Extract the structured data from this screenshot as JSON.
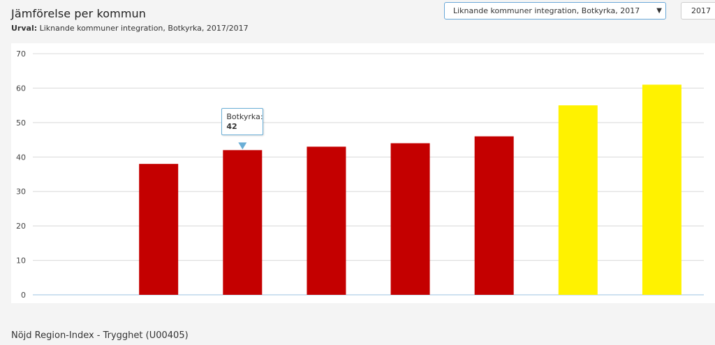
{
  "header": {
    "title": "Jämförelse per kommun",
    "subtitle_label": "Urval:",
    "subtitle_text": "Liknande kommuner integration, Botkyrka, 2017/2017"
  },
  "controls": {
    "comparison_select_value": "Liknande kommuner integration, Botkyrka, 2017",
    "year_select_value": "2017",
    "dropdown_icon": "caret-down-icon"
  },
  "footer": {
    "section_title": "Nöjd Region-Index - Trygghet (U00405)"
  },
  "colors": {
    "red": "#c40000",
    "yellow": "#fff200",
    "grid": "#d8d8d8",
    "axis": "#9ec3e0",
    "accent": "#6aaed6"
  },
  "tooltip": {
    "label": "Botkyrka:",
    "value": "42"
  },
  "chart_data": {
    "type": "bar",
    "categories": [
      "",
      "",
      "Botkyrka",
      "",
      "",
      "",
      "",
      ""
    ],
    "values": [
      null,
      38,
      42,
      43,
      44,
      46,
      55,
      61
    ],
    "colors": [
      "none",
      "red",
      "red",
      "red",
      "red",
      "red",
      "yellow",
      "yellow"
    ],
    "title": "",
    "xlabel": "",
    "ylabel": "",
    "ylim": [
      0,
      70
    ],
    "yticks": [
      "0",
      "10",
      "20",
      "30",
      "40",
      "50",
      "60",
      "70"
    ],
    "grid": true,
    "legend": "none",
    "highlighted_index": 2
  }
}
